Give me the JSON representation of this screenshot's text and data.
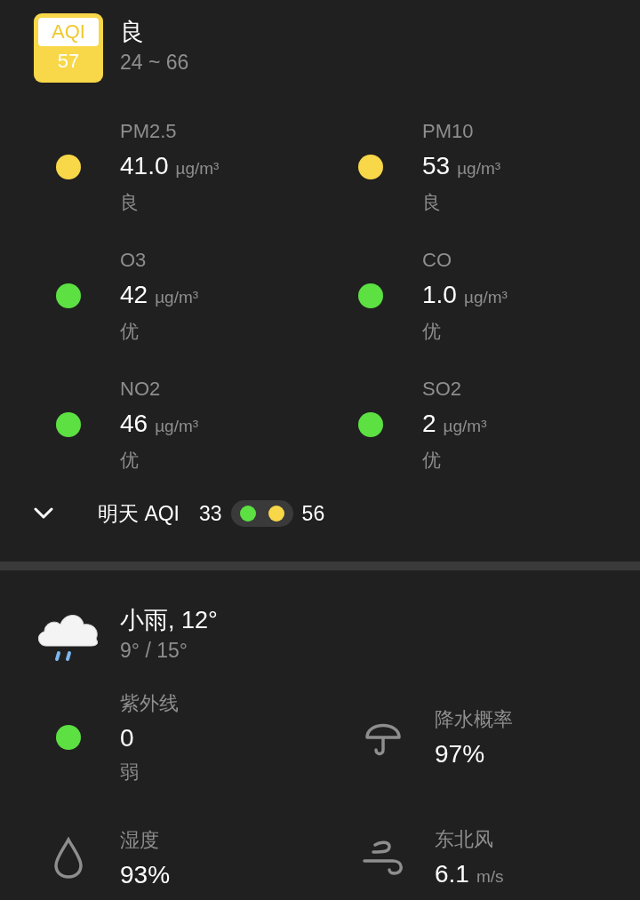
{
  "aqi": {
    "label": "AQI",
    "value": "57",
    "level": "良",
    "range": "24 ~ 66"
  },
  "pollutants": [
    {
      "name": "PM2.5",
      "value": "41.0",
      "unit": "µg/m³",
      "level": "良",
      "color": "#f8d748"
    },
    {
      "name": "PM10",
      "value": "53",
      "unit": "µg/m³",
      "level": "良",
      "color": "#f8d748"
    },
    {
      "name": "O3",
      "value": "42",
      "unit": "µg/m³",
      "level": "优",
      "color": "#5ce042"
    },
    {
      "name": "CO",
      "value": "1.0",
      "unit": "µg/m³",
      "level": "优",
      "color": "#5ce042"
    },
    {
      "name": "NO2",
      "value": "46",
      "unit": "µg/m³",
      "level": "优",
      "color": "#5ce042"
    },
    {
      "name": "SO2",
      "value": "2",
      "unit": "µg/m³",
      "level": "优",
      "color": "#5ce042"
    }
  ],
  "tomorrow": {
    "label": "明天 AQI",
    "low": "33",
    "high": "56",
    "dots": [
      {
        "color": "#5ce042"
      },
      {
        "color": "#f8d748"
      }
    ]
  },
  "weather": {
    "condition": "小雨, 12°",
    "range": "9° / 15°",
    "items": [
      {
        "kind": "indicator",
        "name": "紫外线",
        "value": "0",
        "level": "弱",
        "color": "#5ce042"
      },
      {
        "kind": "umbrella",
        "name": "降水概率",
        "value": "97%"
      },
      {
        "kind": "drop",
        "name": "湿度",
        "value": "93%"
      },
      {
        "kind": "wind",
        "name": "东北风",
        "value": "6.1",
        "unit": "m/s"
      }
    ]
  }
}
